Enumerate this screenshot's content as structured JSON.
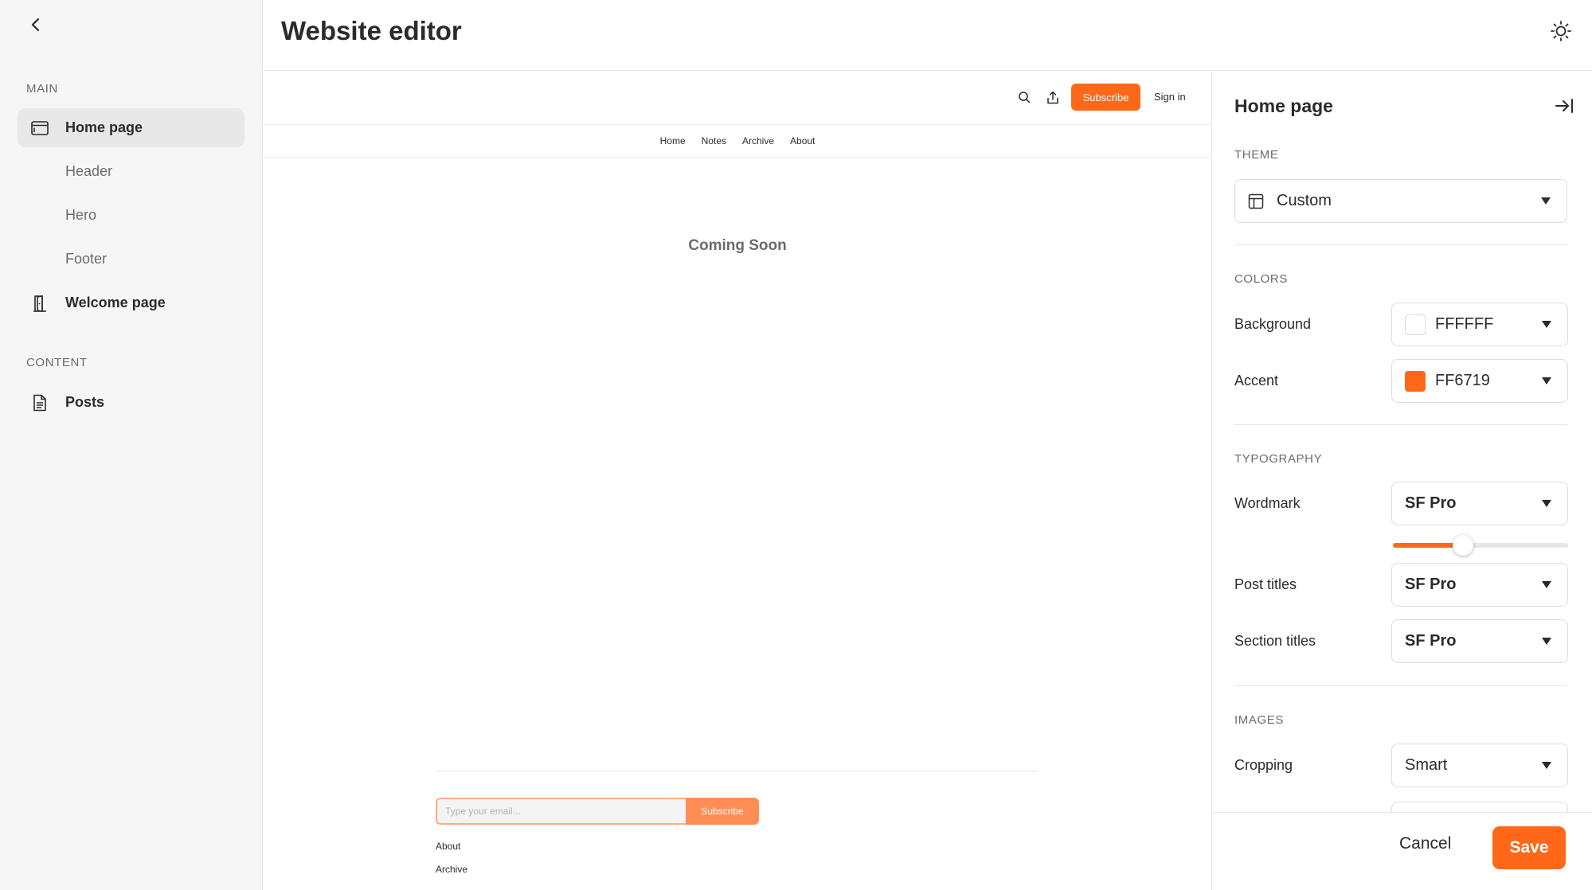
{
  "app": {
    "title": "Website editor"
  },
  "sidebar": {
    "sections": [
      {
        "label": "MAIN"
      },
      {
        "label": "CONTENT"
      }
    ],
    "items": [
      {
        "label": "Home page"
      },
      {
        "label": "Header"
      },
      {
        "label": "Hero"
      },
      {
        "label": "Footer"
      },
      {
        "label": "Welcome page"
      },
      {
        "label": "Posts"
      }
    ]
  },
  "preview": {
    "subscribe_label": "Subscribe",
    "signin_label": "Sign in",
    "nav": [
      "Home",
      "Notes",
      "Archive",
      "About"
    ],
    "message": "Coming Soon",
    "email_placeholder": "Type your email...",
    "email_subscribe_label": "Subscribe",
    "footer_links": [
      "About",
      "Archive"
    ]
  },
  "panel": {
    "title": "Home page",
    "theme": {
      "section": "THEME",
      "value": "Custom"
    },
    "colors": {
      "section": "COLORS",
      "background": {
        "label": "Background",
        "value": "FFFFFF",
        "swatch": "#FFFFFF"
      },
      "accent": {
        "label": "Accent",
        "value": "FF6719",
        "swatch": "#FF6719"
      }
    },
    "typography": {
      "section": "TYPOGRAPHY",
      "wordmark": {
        "label": "Wordmark",
        "value": "SF Pro",
        "size_level": 0.4
      },
      "post_titles": {
        "label": "Post titles",
        "value": "SF Pro"
      },
      "section_titles": {
        "label": "Section titles",
        "value": "SF Pro"
      }
    },
    "images": {
      "section": "IMAGES",
      "cropping": {
        "label": "Cropping",
        "value": "Smart"
      }
    },
    "cancel_label": "Cancel",
    "save_label": "Save"
  },
  "colors": {
    "accent": "#FF6719",
    "sidebar_bg": "#F6F6F6",
    "active_item_bg": "#E8E8E8"
  }
}
